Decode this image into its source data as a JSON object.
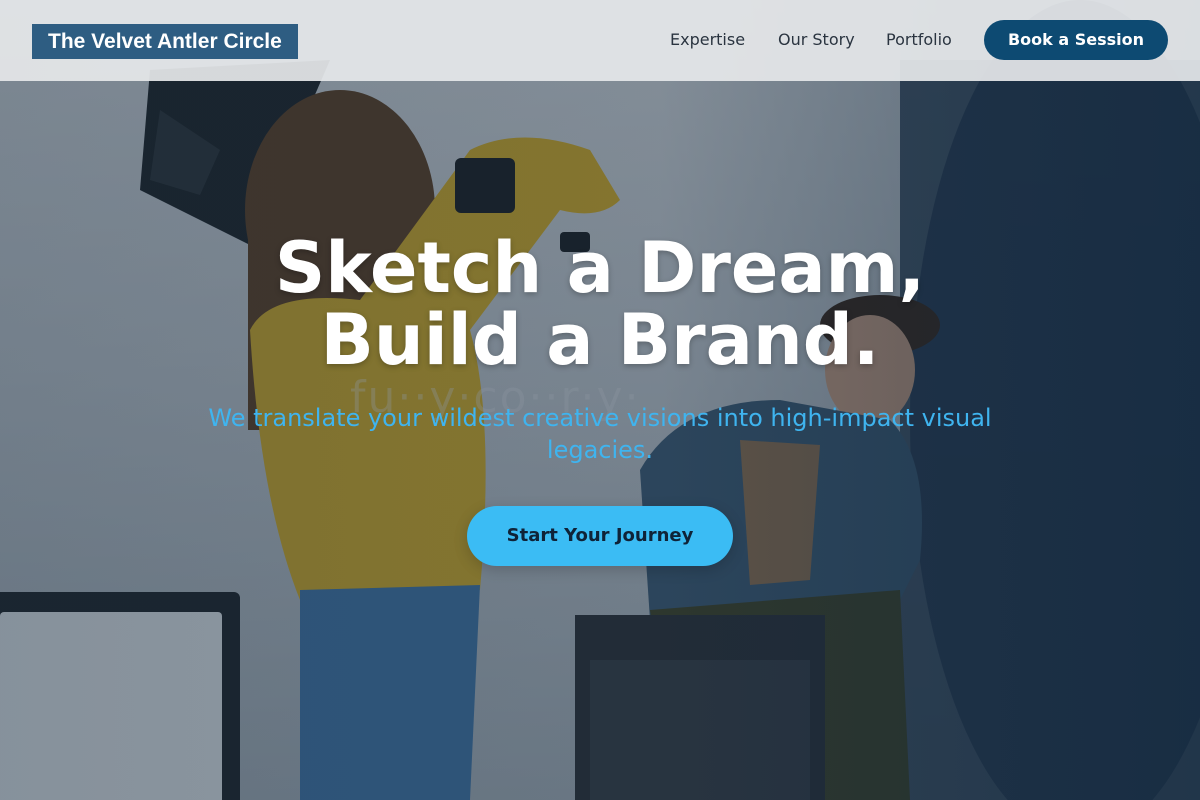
{
  "brand": {
    "name": "The Velvet Antler Circle"
  },
  "nav": {
    "items": [
      {
        "label": "Expertise"
      },
      {
        "label": "Our Story"
      },
      {
        "label": "Portfolio"
      }
    ],
    "cta_label": "Book a Session"
  },
  "hero": {
    "headline_line1": "Sketch a Dream,",
    "headline_line2": "Build a Brand.",
    "subheadline": "We translate your wildest creative visions into high-impact visual legacies.",
    "cta_label": "Start Your Journey",
    "background_image": "photographer-shooting-model-in-studio"
  },
  "colors": {
    "logo_bg": "#2e5d82",
    "nav_cta_bg": "#0d4a72",
    "hero_cta_bg": "#3bbcf4",
    "subheadline": "#3fb4ef"
  }
}
